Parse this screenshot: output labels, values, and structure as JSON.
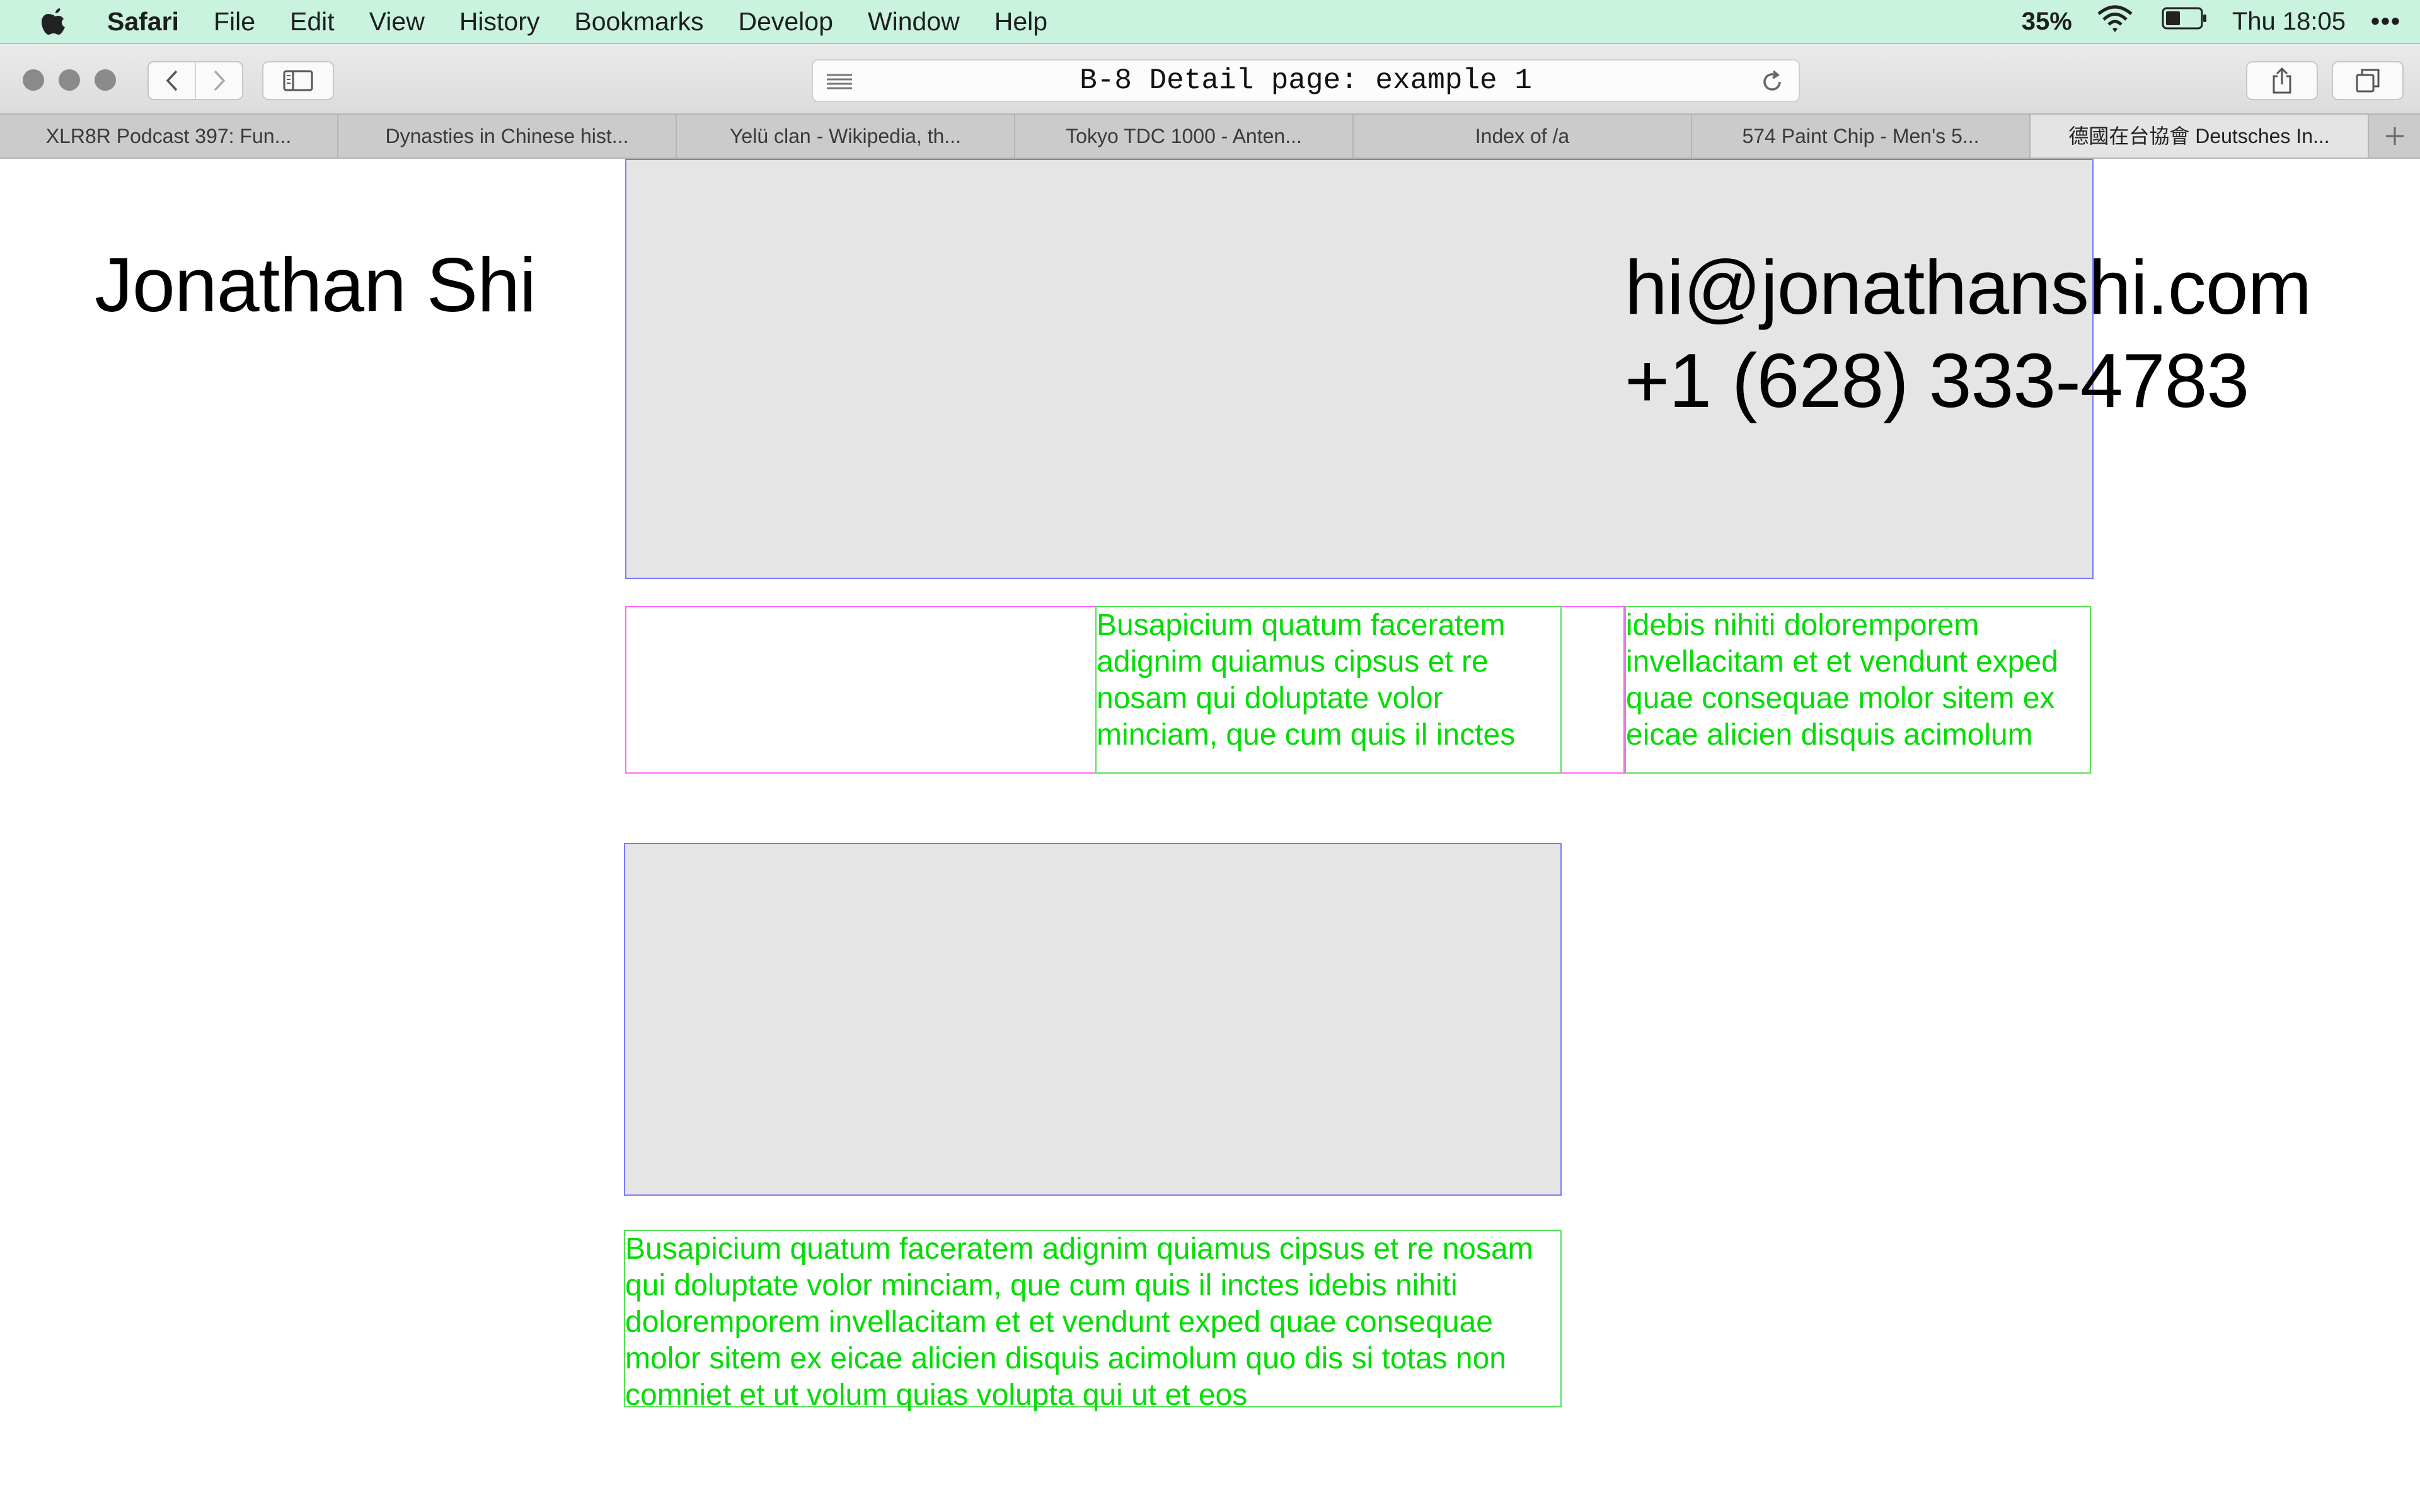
{
  "menubar": {
    "app_name": "Safari",
    "items": [
      "File",
      "Edit",
      "View",
      "History",
      "Bookmarks",
      "Develop",
      "Window",
      "Help"
    ],
    "battery_percent": "35%",
    "clock": "Thu 18:05",
    "more": "•••"
  },
  "toolbar": {
    "address_text": "B-8 Detail page: example 1"
  },
  "tabs": [
    {
      "title": "XLR8R Podcast 397: Fun..."
    },
    {
      "title": "Dynasties in Chinese hist..."
    },
    {
      "title": "Yelü clan - Wikipedia, th..."
    },
    {
      "title": "Tokyo TDC 1000 - Anten..."
    },
    {
      "title": "Index of /a"
    },
    {
      "title": "574 Paint Chip - Men's 5..."
    },
    {
      "title": "德國在台協會 Deutsches In...",
      "active": true
    }
  ],
  "page": {
    "name": "Jonathan Shi",
    "email": "hi@jonathanshi.com",
    "phone": "+1 (628) 333-4783",
    "text_col_a": "Busapicium quatum faceratem adignim quiamus cipsus et re nosam qui doluptate volor minciam, que cum quis il inctes",
    "text_col_b": "idebis nihiti doloremporem invellacitam et et vendunt exped quae consequae molor sitem ex eicae alicien disquis acimolum",
    "caption": "Busapicium quatum faceratem adignim quiamus cipsus et re nosam qui doluptate volor minciam, que cum quis il inctes idebis nihiti doloremporem invellacitam et et vendunt exped quae consequae molor sitem ex eicae alicien disquis acimolum quo dis si totas non comniet et ut volum quias volupta qui ut et eos"
  },
  "colors": {
    "menubar_bg": "#c9f3df",
    "image_placeholder": "#e5e5e5",
    "image_border": "#7a7aff",
    "pink_border": "#ff66ff",
    "green_text": "#00dd00"
  }
}
